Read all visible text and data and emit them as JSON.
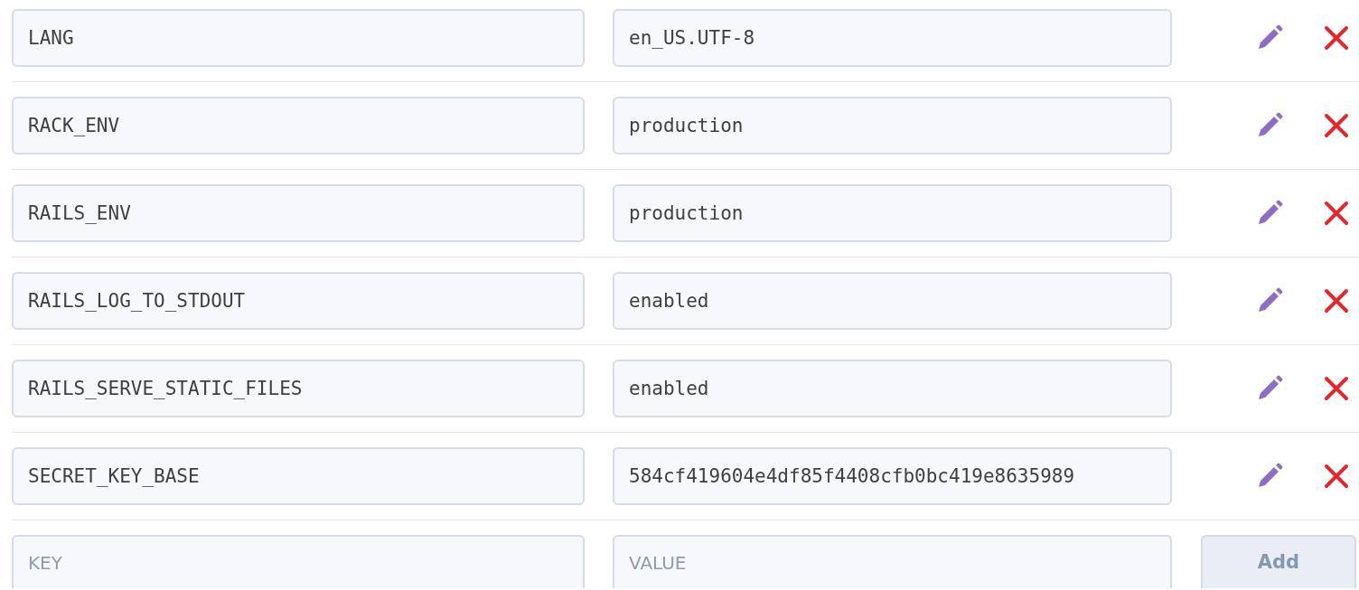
{
  "variables": [
    {
      "key": "LANG",
      "value": "en_US.UTF-8"
    },
    {
      "key": "RACK_ENV",
      "value": "production"
    },
    {
      "key": "RAILS_ENV",
      "value": "production"
    },
    {
      "key": "RAILS_LOG_TO_STDOUT",
      "value": "enabled"
    },
    {
      "key": "RAILS_SERVE_STATIC_FILES",
      "value": "enabled"
    },
    {
      "key": "SECRET_KEY_BASE",
      "value": "584cf419604e4df85f4408cfb0bc419e8635989"
    }
  ],
  "new_variable": {
    "key_placeholder": "KEY",
    "value_placeholder": "VALUE",
    "add_button": {
      "label": "Add",
      "disabled": true
    }
  }
}
